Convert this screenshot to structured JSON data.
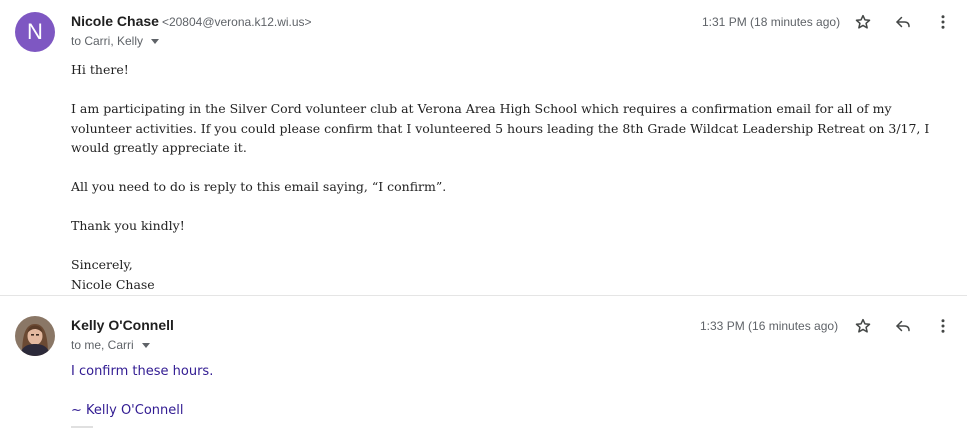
{
  "messages": [
    {
      "avatar_letter": "N",
      "avatar_color": "#7e57c2",
      "sender_name": "Nicole Chase",
      "sender_email": "<20804@verona.k12.wi.us>",
      "recipients": "to Carri, Kelly",
      "time": "1:31 PM (18 minutes ago)",
      "body": {
        "greeting": "Hi there!",
        "paragraph1": "I am participating in the Silver Cord volunteer club at Verona Area High School which requires a confirmation email for all of my volunteer activities. If you could please confirm that I volunteered 5 hours leading the 8th Grade Wildcat Leadership Retreat on 3/17, I would greatly appreciate it.",
        "paragraph2": "All you need to do is reply to this email saying, “I confirm”.",
        "paragraph3": "Thank you kindly!",
        "closing": "Sincerely,",
        "signature": "Nicole Chase"
      }
    },
    {
      "sender_name": "Kelly O'Connell",
      "recipients": "to me, Carri",
      "time": "1:33 PM (16 minutes ago)",
      "body": {
        "line1": "I confirm these hours.",
        "signature": "~ Kelly O'Connell"
      }
    }
  ],
  "icons": {
    "star": "star-icon",
    "reply": "reply-icon",
    "more": "more-vert-icon",
    "expand": "chevron-down-icon"
  },
  "colors": {
    "reply_text": "#311b92",
    "secondary_text": "#5f6368"
  }
}
